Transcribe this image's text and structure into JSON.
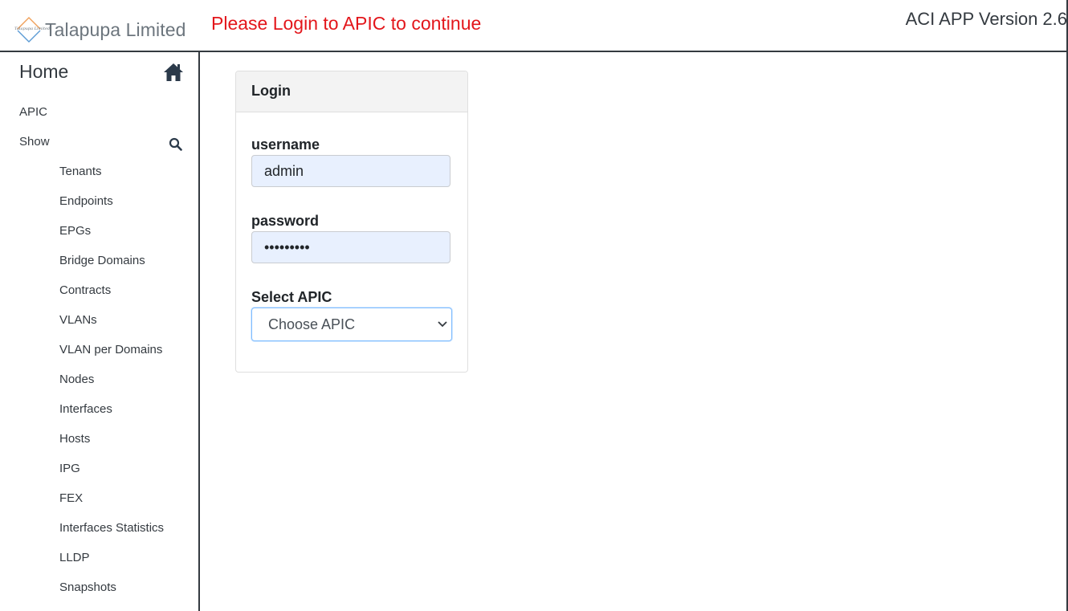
{
  "header": {
    "brand_name": "Talapupa Limited",
    "brand_logo_text": "Talapupa Limited",
    "login_message": "Please Login to APIC to continue",
    "version": "ACI APP Version 2.6"
  },
  "sidebar": {
    "home_label": "Home",
    "apic_label": "APIC",
    "show_label": "Show",
    "items": [
      {
        "label": "Tenants"
      },
      {
        "label": "Endpoints"
      },
      {
        "label": "EPGs"
      },
      {
        "label": "Bridge Domains"
      },
      {
        "label": "Contracts"
      },
      {
        "label": "VLANs"
      },
      {
        "label": "VLAN per Domains"
      },
      {
        "label": "Nodes"
      },
      {
        "label": "Interfaces"
      },
      {
        "label": "Hosts"
      },
      {
        "label": "IPG"
      },
      {
        "label": "FEX"
      },
      {
        "label": "Interfaces Statistics"
      },
      {
        "label": "LLDP"
      },
      {
        "label": "Snapshots"
      }
    ]
  },
  "login": {
    "title": "Login",
    "username_label": "username",
    "username_value": "admin",
    "password_label": "password",
    "password_value": "•••••••••",
    "select_label": "Select APIC",
    "select_value": "Choose APIC"
  },
  "icons": {
    "home": "home-icon",
    "search": "search-icon",
    "chevron": "chevron-down-icon"
  },
  "colors": {
    "login_message": "#e3161b",
    "input_autofill": "#e8f0fe",
    "select_focus": "#80bdff",
    "card_header": "#f3f3f3"
  }
}
